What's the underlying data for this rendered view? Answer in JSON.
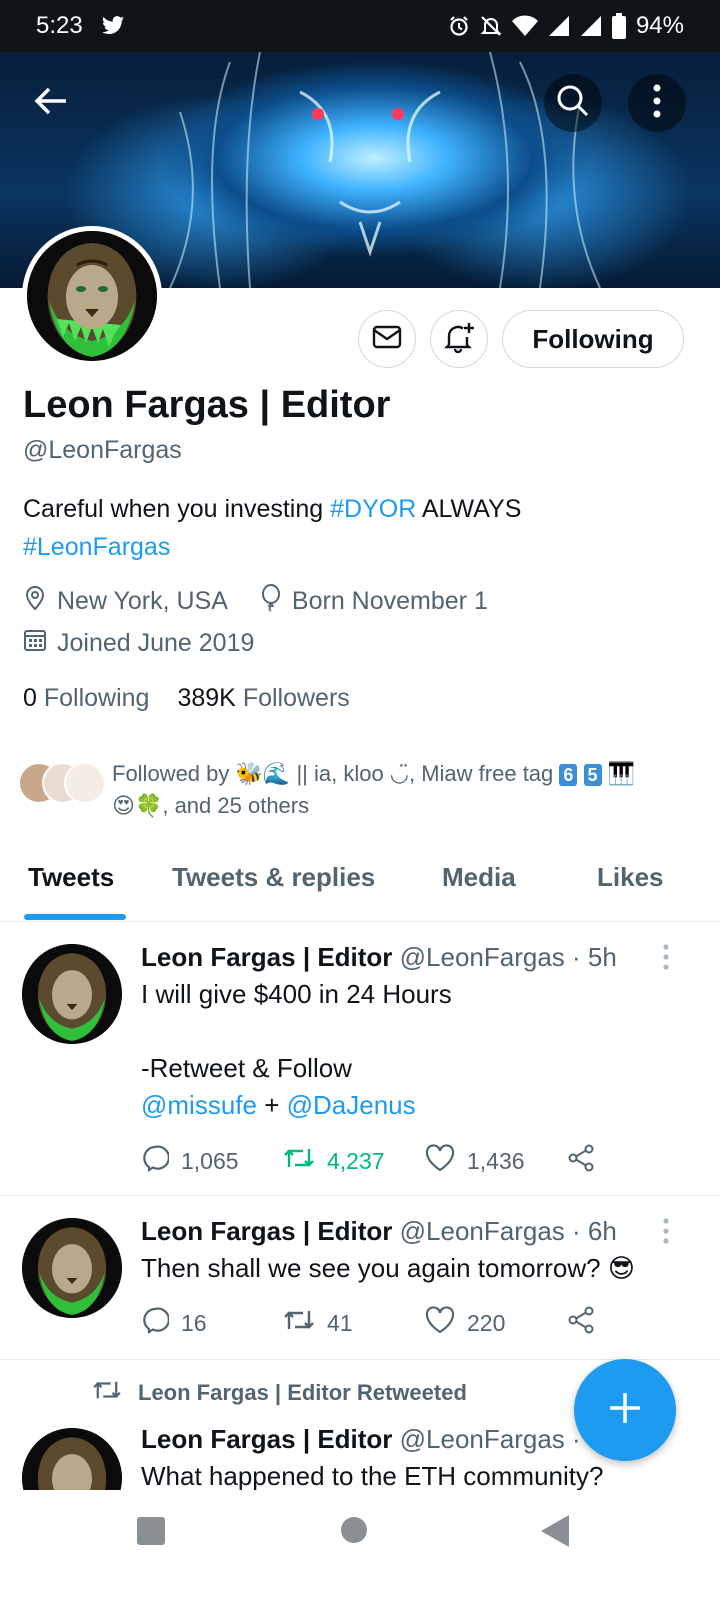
{
  "status_bar": {
    "time": "5:23",
    "battery": "94%"
  },
  "profile": {
    "name": "Leon Fargas | Editor",
    "handle": "@LeonFargas",
    "follow_button": "Following",
    "bio_text": "Careful when you investing ",
    "bio_tag1": "#DYOR",
    "bio_text2": " ALWAYS",
    "bio_tag2": "#LeonFargas",
    "location": "New York, USA",
    "birthday": "Born November 1",
    "joined": "Joined June 2019",
    "following_count": "0",
    "following_label": "Following",
    "followers_count": "389K",
    "followers_label": "Followers",
    "followed_by_prefix": "Followed by ",
    "followed_by_names": " || ia, kloo ◡̈, Miaw free tag ",
    "followed_by_badges": [
      "6",
      "5"
    ],
    "followed_by_suffix": ", and 25 others"
  },
  "tabs": [
    "Tweets",
    "Tweets & replies",
    "Media",
    "Likes"
  ],
  "tweets": [
    {
      "name": "Leon Fargas | Editor",
      "handle": "@LeonFargas",
      "time": " · 5h",
      "line1": "I will give $400 in 24 Hours",
      "line2": "-Retweet & Follow",
      "mention1": "@missufe",
      "plus": " + ",
      "mention2": "@DaJenus",
      "replies": "1,065",
      "retweets": "4,237",
      "likes": "1,436"
    },
    {
      "name": "Leon Fargas | Editor",
      "handle": "@LeonFargas",
      "time": " · 6h",
      "text": "Then shall we see you again tomorrow?",
      "replies": "16",
      "retweets": "41",
      "likes": "220"
    },
    {
      "retweet_label": "Leon Fargas | Editor Retweeted",
      "name": "Leon Fargas | Editor",
      "handle": "@LeonFargas",
      "time": " ·",
      "text": "What happened to the ETH community?"
    }
  ],
  "colors": {
    "accent": "#1d9bf0",
    "retweet_green": "#00ba7c",
    "muted": "#536471"
  }
}
